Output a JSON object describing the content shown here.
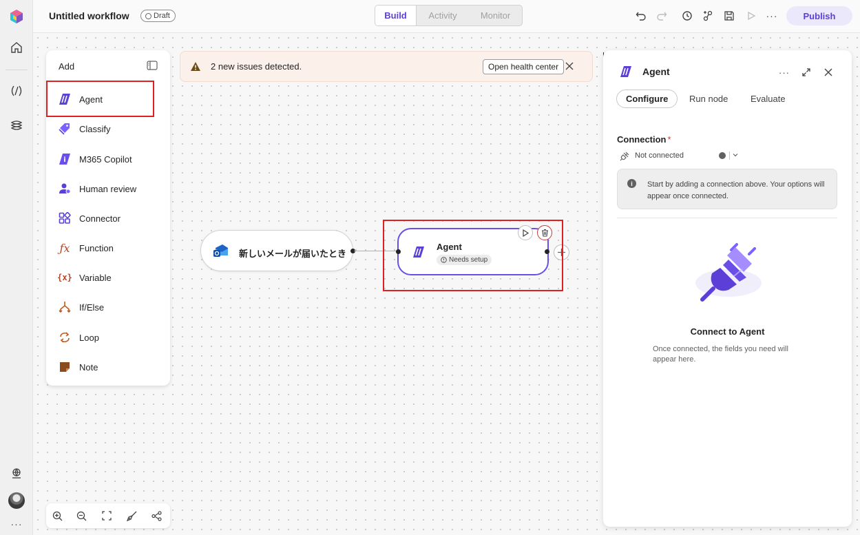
{
  "workflow": {
    "title": "Untitled workflow",
    "status_badge": "Draft"
  },
  "top_tabs": [
    {
      "label": "Build",
      "active": true
    },
    {
      "label": "Activity",
      "active": false
    },
    {
      "label": "Monitor",
      "active": false
    }
  ],
  "toolbar": {
    "publish_label": "Publish",
    "icons": [
      "undo-icon",
      "redo-icon",
      "history-icon",
      "connections-icon",
      "save-icon",
      "run-icon",
      "more-icon"
    ]
  },
  "rail": {
    "icons": [
      "app-logo-icon",
      "home-icon",
      "agents-icon",
      "knowledge-icon",
      "environment-icon",
      "avatar",
      "more-icon"
    ]
  },
  "add_panel": {
    "title": "Add",
    "items": [
      {
        "label": "Agent",
        "icon": "agent-icon"
      },
      {
        "label": "Classify",
        "icon": "classify-tag-icon"
      },
      {
        "label": "M365 Copilot",
        "icon": "copilot-icon"
      },
      {
        "label": "Human review",
        "icon": "human-review-icon"
      },
      {
        "label": "Connector",
        "icon": "connector-icon"
      },
      {
        "label": "Function",
        "icon": "function-fx-icon"
      },
      {
        "label": "Variable",
        "icon": "variable-icon"
      },
      {
        "label": "If/Else",
        "icon": "branch-icon"
      },
      {
        "label": "Loop",
        "icon": "loop-icon"
      },
      {
        "label": "Note",
        "icon": "note-icon"
      }
    ]
  },
  "banner": {
    "message": "2 new issues detected.",
    "action_label": "Open health center"
  },
  "nodes": {
    "trigger": {
      "label": "新しいメールが届いたとき",
      "icon": "outlook-mail-icon"
    },
    "agent": {
      "label": "Agent",
      "status": "Needs setup"
    }
  },
  "props_panel": {
    "title": "Agent",
    "tabs": [
      {
        "label": "Configure",
        "active": true
      },
      {
        "label": "Run node",
        "active": false
      },
      {
        "label": "Evaluate",
        "active": false
      }
    ],
    "connection": {
      "label": "Connection",
      "required_mark": "*",
      "value": "Not connected"
    },
    "info_text": "Start by adding a connection above. Your options will appear once connected.",
    "empty_state": {
      "title": "Connect to Agent",
      "description": "Once connected, the fields you need will appear here."
    }
  },
  "colors": {
    "accent": "#5b3fd6",
    "node_border": "#6b4ee6",
    "banner_bg": "#fbf0ea",
    "highlight": "#e02020"
  }
}
